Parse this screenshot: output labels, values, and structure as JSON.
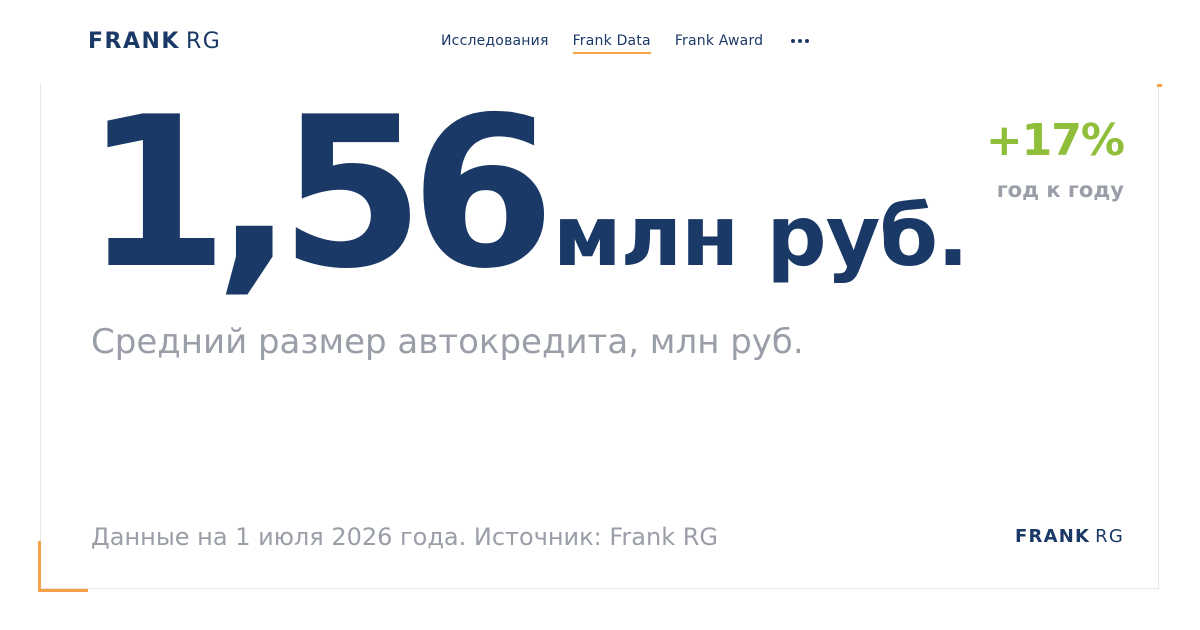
{
  "header": {
    "logo": {
      "bold": "FRANK",
      "light": "RG"
    },
    "nav": [
      {
        "label": "Исследования",
        "active": false
      },
      {
        "label": "Frank Data",
        "active": true
      },
      {
        "label": "Frank Award",
        "active": false
      }
    ],
    "more_icon": "ellipsis-icon"
  },
  "metric": {
    "value": "1,56",
    "unit": "млн руб.",
    "change": "+17%",
    "change_label": "год к году",
    "subtitle": "Средний размер автокредита, млн руб."
  },
  "footer": {
    "note": "Данные на 1 июля 2026 года. Источник: Frank RG",
    "logo": {
      "bold": "FRANK",
      "light": "RG"
    }
  },
  "colors": {
    "brand": "#1b3966",
    "accent": "#f6a048",
    "positive": "#8fbf3a",
    "muted": "#9a9ea8"
  }
}
